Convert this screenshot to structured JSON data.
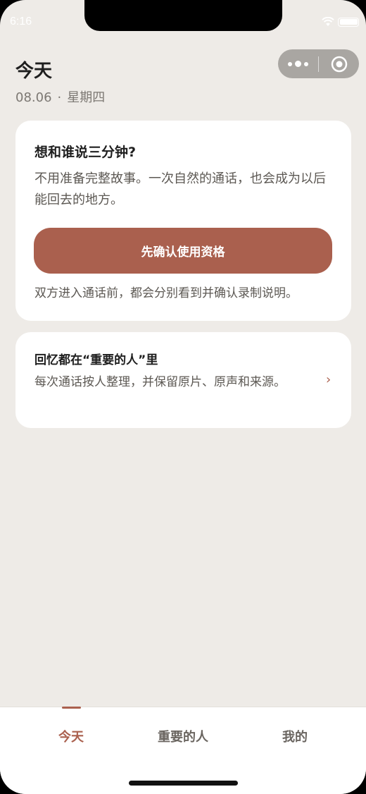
{
  "status_bar": {
    "time": "6:16",
    "icons": [
      "wifi-icon",
      "battery-icon"
    ]
  },
  "header": {
    "title": "今天",
    "date": "08.06",
    "separator": "·",
    "weekday": "星期四"
  },
  "capsule": {
    "icons": [
      "more-dots-icon",
      "close-target-icon"
    ]
  },
  "call_card": {
    "title": "想和谁说三分钟?",
    "description": "不用准备完整故事。一次自然的通话，也会成为以后能回去的地方。",
    "button_label": "先确认使用资格",
    "note": "双方进入通话前，都会分别看到并确认录制说明。"
  },
  "memory_card": {
    "title": "回忆都在“重要的人”里",
    "description": "每次通话按人整理，并保留原片、原声和来源。",
    "chevron": "›"
  },
  "tabbar": {
    "tabs": [
      {
        "label": "今天",
        "active": true
      },
      {
        "label": "重要的人",
        "active": false
      },
      {
        "label": "我的",
        "active": false
      }
    ]
  },
  "colors": {
    "accent": "#AA604E",
    "background": "#EEEBE7",
    "card": "#FFFFFF",
    "title_text": "#1E1E1E",
    "body_text": "#5C5853"
  }
}
